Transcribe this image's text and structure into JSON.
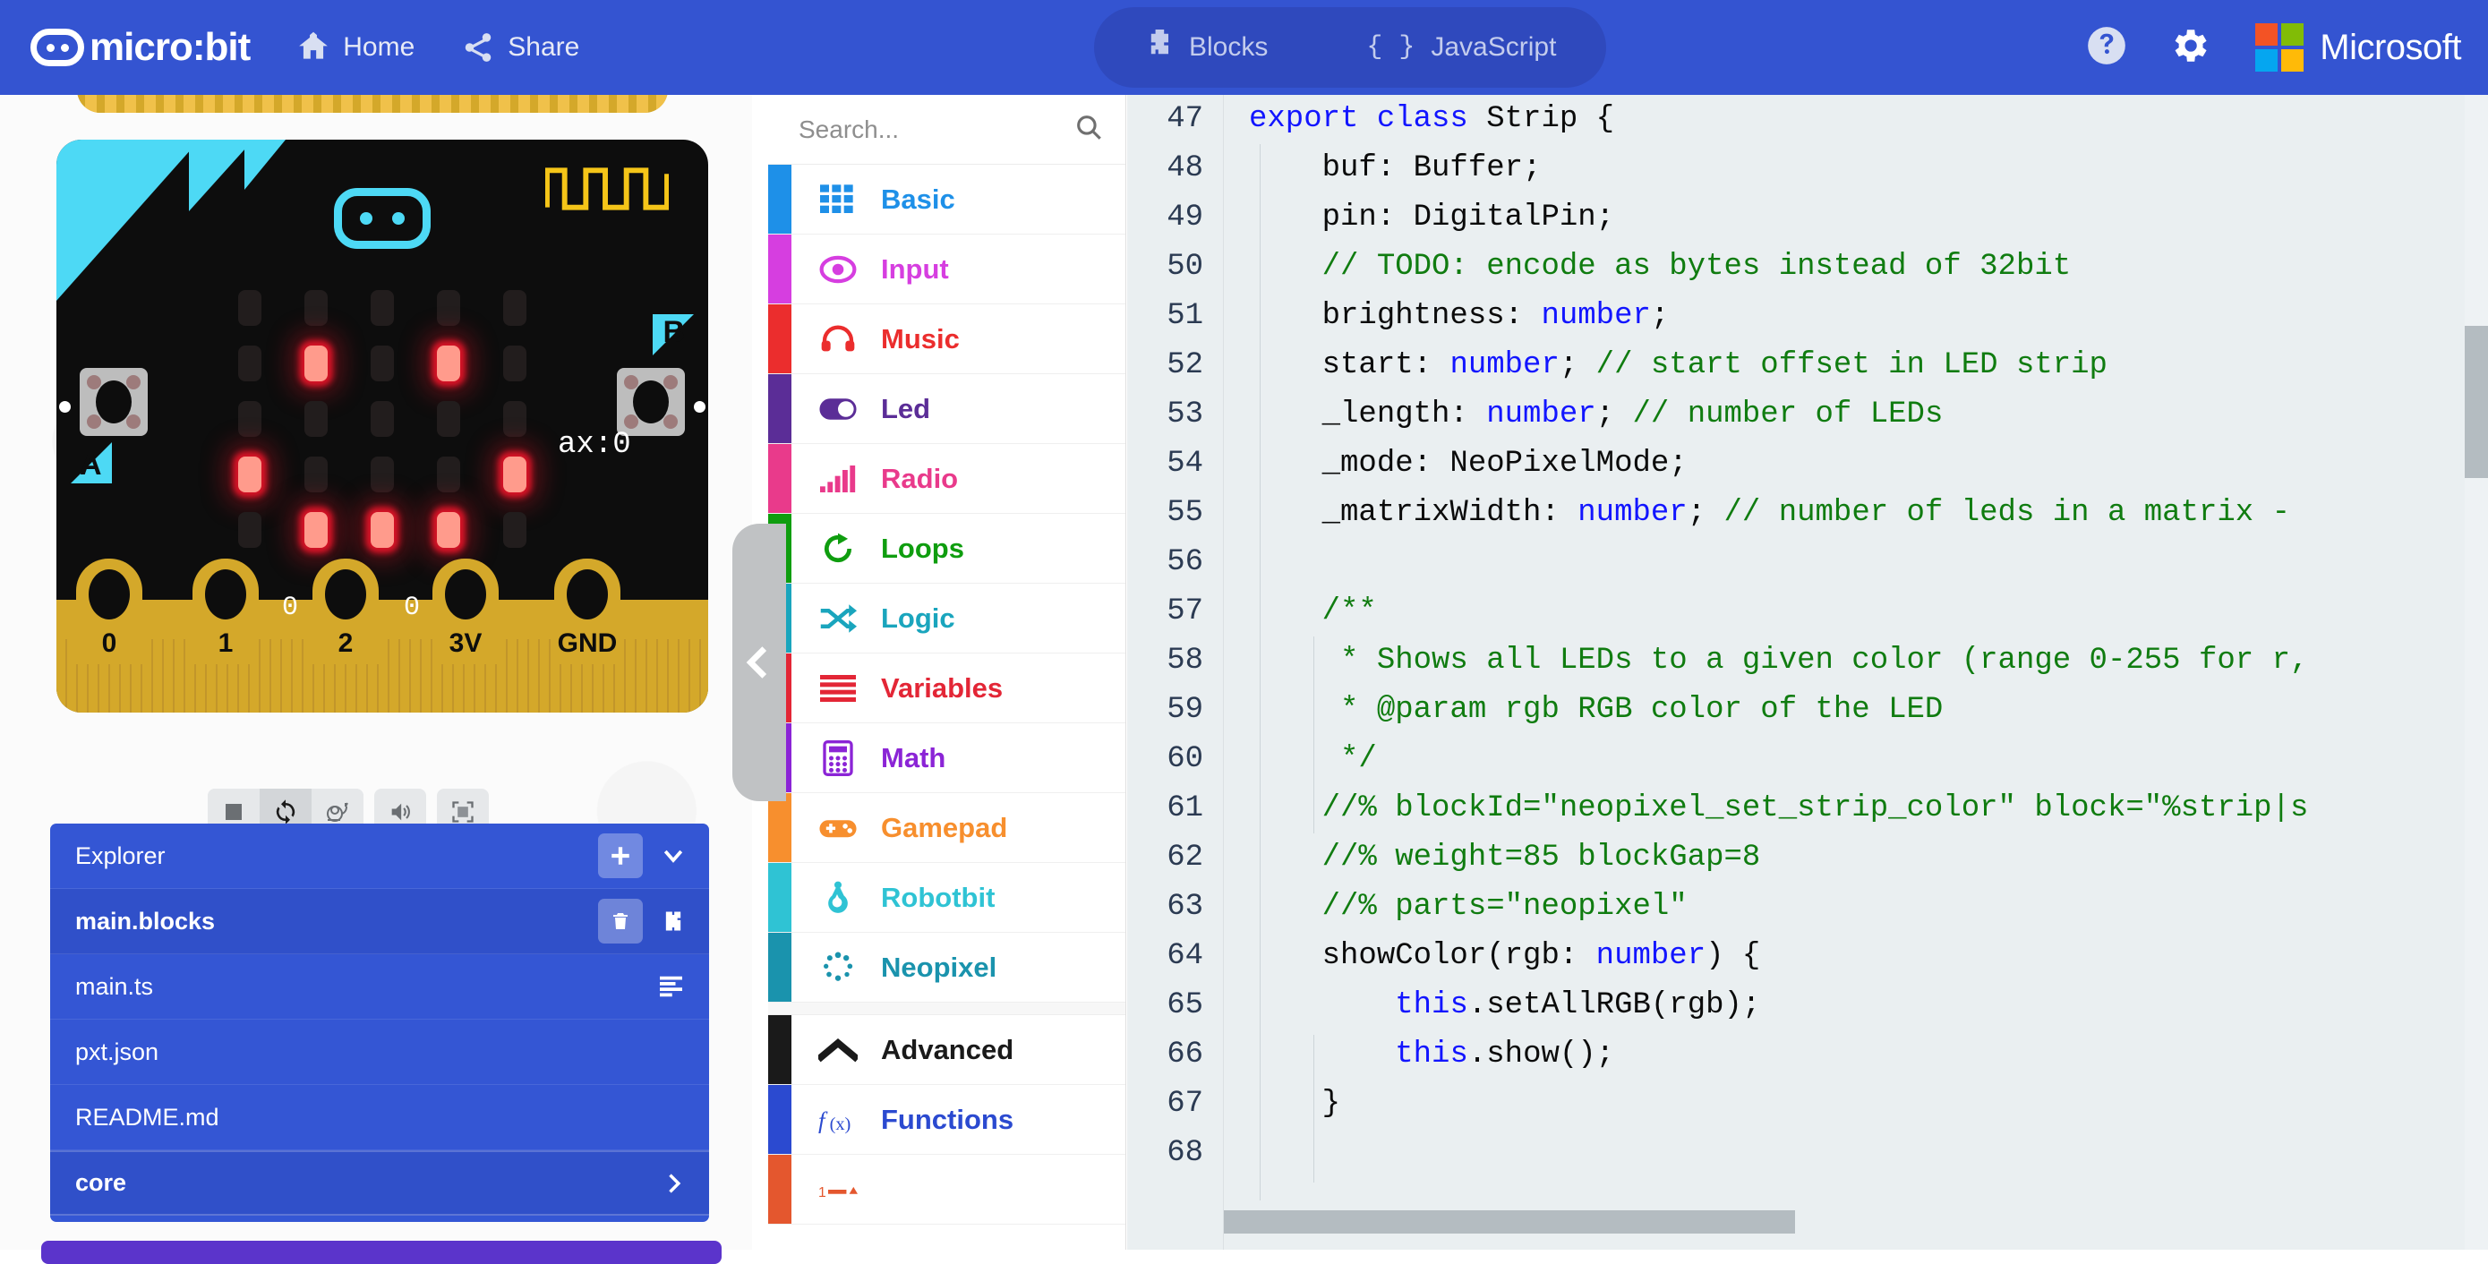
{
  "header": {
    "brand": "micro:bit",
    "home_label": "Home",
    "share_label": "Share",
    "tab_blocks": "Blocks",
    "tab_javascript": "JavaScript",
    "js_braces": "{ }",
    "microsoft_label": "Microsoft",
    "brand_blue": "#3454d1",
    "tab_pill_blue": "#2f49bd",
    "ms_colors": [
      "#f35325",
      "#81bc06",
      "#05a6f0",
      "#ffba08"
    ]
  },
  "simulator": {
    "ax_readout": "ax:0",
    "flag_a": "A",
    "flag_b": "B",
    "pins": [
      {
        "label": "0",
        "value": ""
      },
      {
        "label": "1",
        "value": "0"
      },
      {
        "label": "2",
        "value": "0"
      },
      {
        "label": "3V",
        "value": ""
      },
      {
        "label": "GND",
        "value": ""
      }
    ],
    "led_matrix": [
      [
        0,
        0,
        0,
        0,
        0
      ],
      [
        0,
        1,
        0,
        1,
        0
      ],
      [
        0,
        0,
        0,
        0,
        0
      ],
      [
        1,
        0,
        0,
        0,
        1
      ],
      [
        0,
        1,
        1,
        1,
        0
      ]
    ],
    "controls": [
      {
        "name": "stop-button",
        "icon": "stop-icon"
      },
      {
        "name": "restart-button",
        "icon": "restart-icon"
      },
      {
        "name": "slow-motion-button",
        "icon": "snail-icon"
      },
      {
        "name": "mute-button",
        "icon": "speaker-icon"
      },
      {
        "name": "fullscreen-button",
        "icon": "fullscreen-icon"
      }
    ],
    "led_on_color": "#ff9b8c",
    "board_accent": "#4dd9f5",
    "pin_gold": "#d4a82a"
  },
  "explorer": {
    "title": "Explorer",
    "add_label": "+",
    "rows": [
      {
        "name": "main.blocks",
        "selected": true,
        "actions": [
          "delete-icon",
          "blocks-icon"
        ]
      },
      {
        "name": "main.ts",
        "selected": false,
        "actions": [
          "lines-icon"
        ]
      },
      {
        "name": "pxt.json",
        "selected": false,
        "actions": []
      },
      {
        "name": "README.md",
        "selected": false,
        "actions": []
      }
    ],
    "footer": {
      "name": "core",
      "chevron": "chevron-right-icon"
    },
    "panel_blue": "#3456d4"
  },
  "toolbox": {
    "search_placeholder": "Search...",
    "categories": [
      {
        "label": "Basic",
        "color": "#1e90e8",
        "icon": "grid-icon"
      },
      {
        "label": "Input",
        "color": "#d63ee0",
        "icon": "eye-icon"
      },
      {
        "label": "Music",
        "color": "#eb2d2d",
        "icon": "headphones-icon"
      },
      {
        "label": "Led",
        "color": "#5b2d97",
        "icon": "toggle-icon"
      },
      {
        "label": "Radio",
        "color": "#e93a8b",
        "icon": "signal-icon"
      },
      {
        "label": "Loops",
        "color": "#0f9d0f",
        "icon": "loop-icon"
      },
      {
        "label": "Logic",
        "color": "#1aa5bd",
        "icon": "shuffle-icon"
      },
      {
        "label": "Variables",
        "color": "#e32636",
        "icon": "list-icon"
      },
      {
        "label": "Math",
        "color": "#8b24d6",
        "icon": "calculator-icon"
      },
      {
        "label": "Gamepad",
        "color": "#f78f2e",
        "icon": "gamepad-icon"
      },
      {
        "label": "Robotbit",
        "color": "#2fc3d4",
        "icon": "robot-icon"
      },
      {
        "label": "Neopixel",
        "color": "#1a93ad",
        "icon": "neopixel-icon"
      }
    ],
    "advanced": {
      "label": "Advanced",
      "color": "#1a1a1a",
      "icon": "chevron-up-icon"
    },
    "advanced_categories": [
      {
        "label": "Functions",
        "color": "#2b4ad0",
        "icon": "function-icon"
      },
      {
        "label": "",
        "color": "#e4572e",
        "icon": "arrays-icon"
      }
    ]
  },
  "editor": {
    "first_line_number": 47,
    "lines": [
      {
        "n": 47,
        "tokens": [
          {
            "t": "export class ",
            "c": "blue"
          },
          {
            "t": "Strip {",
            "c": "black"
          }
        ]
      },
      {
        "n": 48,
        "tokens": [
          {
            "t": "    buf: Buffer;",
            "c": "black"
          }
        ]
      },
      {
        "n": 49,
        "tokens": [
          {
            "t": "    pin: DigitalPin;",
            "c": "black"
          }
        ]
      },
      {
        "n": 50,
        "tokens": [
          {
            "t": "    // TODO: encode as bytes instead of 32bit",
            "c": "green"
          }
        ]
      },
      {
        "n": 51,
        "tokens": [
          {
            "t": "    brightness: ",
            "c": "black"
          },
          {
            "t": "number",
            "c": "blue"
          },
          {
            "t": ";",
            "c": "black"
          }
        ]
      },
      {
        "n": 52,
        "tokens": [
          {
            "t": "    start: ",
            "c": "black"
          },
          {
            "t": "number",
            "c": "blue"
          },
          {
            "t": "; ",
            "c": "black"
          },
          {
            "t": "// start offset in LED strip",
            "c": "green"
          }
        ]
      },
      {
        "n": 53,
        "tokens": [
          {
            "t": "    _length: ",
            "c": "black"
          },
          {
            "t": "number",
            "c": "blue"
          },
          {
            "t": "; ",
            "c": "black"
          },
          {
            "t": "// number of LEDs",
            "c": "green"
          }
        ]
      },
      {
        "n": 54,
        "tokens": [
          {
            "t": "    _mode: NeoPixelMode;",
            "c": "black"
          }
        ]
      },
      {
        "n": 55,
        "tokens": [
          {
            "t": "    _matrixWidth: ",
            "c": "black"
          },
          {
            "t": "number",
            "c": "blue"
          },
          {
            "t": "; ",
            "c": "black"
          },
          {
            "t": "// number of leds in a matrix -",
            "c": "green"
          }
        ]
      },
      {
        "n": 56,
        "tokens": [
          {
            "t": "",
            "c": "black"
          }
        ]
      },
      {
        "n": 57,
        "tokens": [
          {
            "t": "    /**",
            "c": "green"
          }
        ]
      },
      {
        "n": 58,
        "tokens": [
          {
            "t": "     * Shows all LEDs to a given color (range 0-255 for r,",
            "c": "green"
          }
        ]
      },
      {
        "n": 59,
        "tokens": [
          {
            "t": "     * @param rgb RGB color of the LED",
            "c": "green"
          }
        ]
      },
      {
        "n": 60,
        "tokens": [
          {
            "t": "     */",
            "c": "green"
          }
        ]
      },
      {
        "n": 61,
        "tokens": [
          {
            "t": "    //% blockId=\"neopixel_set_strip_color\" block=\"%strip|s",
            "c": "green"
          }
        ]
      },
      {
        "n": 62,
        "tokens": [
          {
            "t": "    //% weight=85 blockGap=8",
            "c": "green"
          }
        ]
      },
      {
        "n": 63,
        "tokens": [
          {
            "t": "    //% parts=\"neopixel\"",
            "c": "green"
          }
        ]
      },
      {
        "n": 64,
        "tokens": [
          {
            "t": "    showColor(rgb: ",
            "c": "black"
          },
          {
            "t": "number",
            "c": "blue"
          },
          {
            "t": ") {",
            "c": "black"
          }
        ]
      },
      {
        "n": 65,
        "tokens": [
          {
            "t": "        ",
            "c": "black"
          },
          {
            "t": "this",
            "c": "blue"
          },
          {
            "t": ".setAllRGB(rgb);",
            "c": "black"
          }
        ]
      },
      {
        "n": 66,
        "tokens": [
          {
            "t": "        ",
            "c": "black"
          },
          {
            "t": "this",
            "c": "blue"
          },
          {
            "t": ".show();",
            "c": "black"
          }
        ]
      },
      {
        "n": 67,
        "tokens": [
          {
            "t": "    }",
            "c": "black"
          }
        ]
      },
      {
        "n": 68,
        "tokens": [
          {
            "t": "",
            "c": "black"
          }
        ]
      }
    ],
    "background": "#eaeff1",
    "keyword_color": "#1215ff",
    "comment_color": "#107c10"
  }
}
